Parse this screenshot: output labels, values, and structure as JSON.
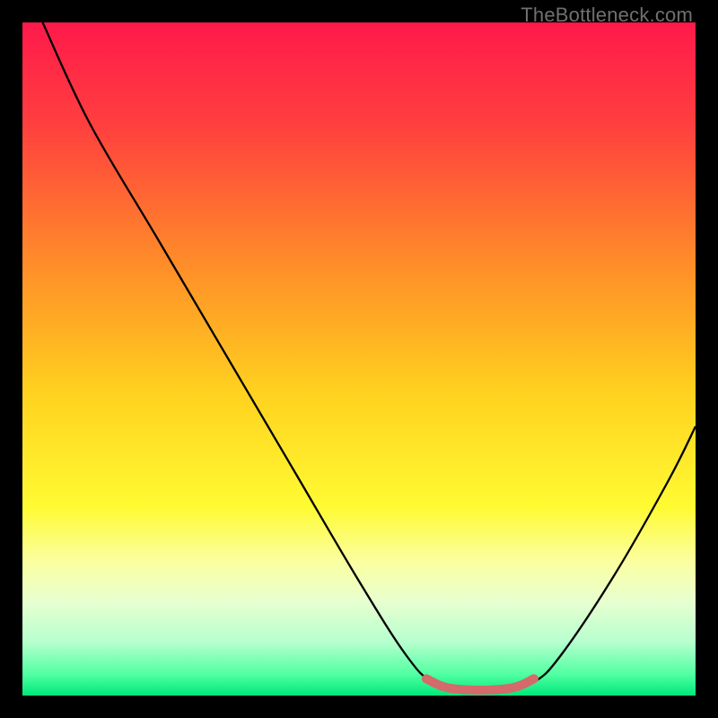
{
  "watermark": "TheBottleneck.com",
  "chart_data": {
    "type": "line",
    "title": "",
    "xlabel": "",
    "ylabel": "",
    "xlim": [
      0,
      100
    ],
    "ylim": [
      0,
      100
    ],
    "gradient_stops": [
      {
        "pos": 0.0,
        "color": "#ff1a4b"
      },
      {
        "pos": 0.15,
        "color": "#ff3f3f"
      },
      {
        "pos": 0.35,
        "color": "#ff8a2a"
      },
      {
        "pos": 0.55,
        "color": "#ffd21f"
      },
      {
        "pos": 0.72,
        "color": "#fffb33"
      },
      {
        "pos": 0.8,
        "color": "#fbffa0"
      },
      {
        "pos": 0.86,
        "color": "#e8ffd0"
      },
      {
        "pos": 0.92,
        "color": "#b8ffcf"
      },
      {
        "pos": 0.97,
        "color": "#4dffa0"
      },
      {
        "pos": 1.0,
        "color": "#00e87a"
      }
    ],
    "series": [
      {
        "name": "bottleneck-curve",
        "color": "#000000",
        "stroke_width": 2.3,
        "points": [
          {
            "x": 3,
            "y": 100
          },
          {
            "x": 10,
            "y": 85
          },
          {
            "x": 20,
            "y": 68
          },
          {
            "x": 30,
            "y": 51
          },
          {
            "x": 40,
            "y": 34
          },
          {
            "x": 50,
            "y": 17
          },
          {
            "x": 57,
            "y": 6
          },
          {
            "x": 61,
            "y": 2
          },
          {
            "x": 66,
            "y": 1
          },
          {
            "x": 72,
            "y": 1
          },
          {
            "x": 76,
            "y": 2
          },
          {
            "x": 80,
            "y": 6
          },
          {
            "x": 88,
            "y": 18
          },
          {
            "x": 96,
            "y": 32
          },
          {
            "x": 100,
            "y": 40
          }
        ]
      },
      {
        "name": "optimal-segment",
        "color": "#d46a6a",
        "stroke_width": 10,
        "points": [
          {
            "x": 60,
            "y": 2.5
          },
          {
            "x": 63,
            "y": 1.2
          },
          {
            "x": 68,
            "y": 0.8
          },
          {
            "x": 73,
            "y": 1.2
          },
          {
            "x": 76,
            "y": 2.5
          }
        ]
      }
    ]
  }
}
